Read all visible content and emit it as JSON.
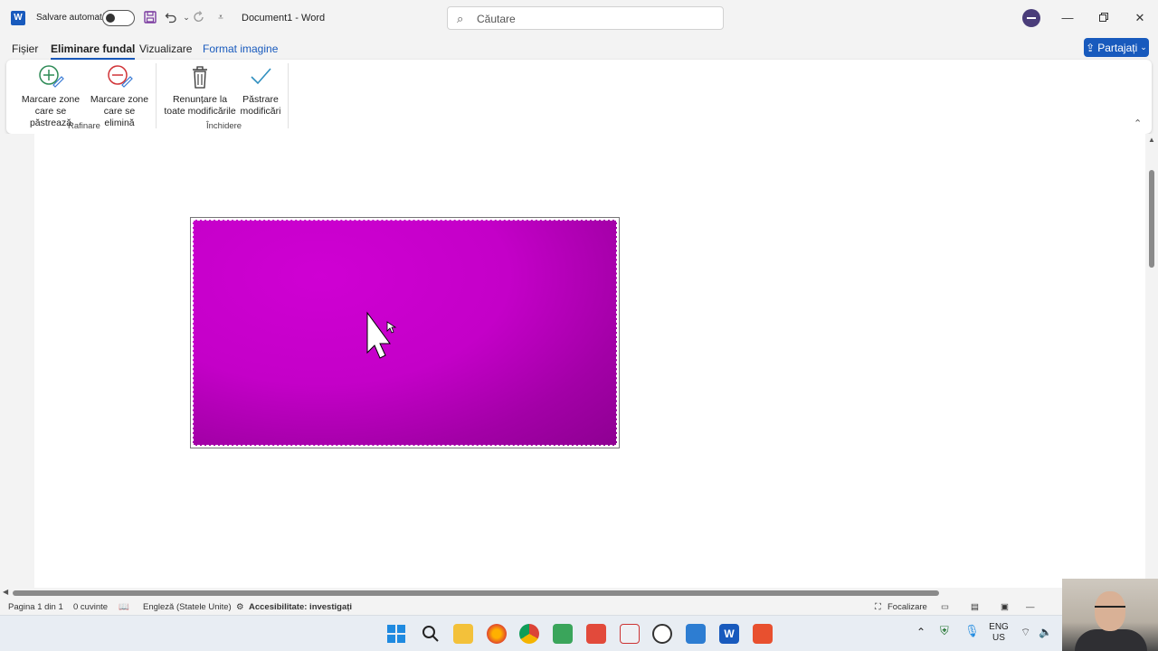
{
  "titlebar": {
    "app_badge": "W",
    "autosave_label": "Salvare automată",
    "doc_title": "Document1  -  Word",
    "search_placeholder": "Căutare"
  },
  "tabs": [
    {
      "label": "Fișier"
    },
    {
      "label": "Eliminare fundal"
    },
    {
      "label": "Vizualizare"
    },
    {
      "label": "Format imagine"
    }
  ],
  "share_label": "Partajați",
  "ribbon": {
    "mark_keep": {
      "line1": "Marcare zone",
      "line2": "care se păstrează"
    },
    "mark_remove": {
      "line1": "Marcare zone",
      "line2": "care se elimină"
    },
    "discard": {
      "line1": "Renunțare la",
      "line2": "toate modificările"
    },
    "keep_changes": {
      "line1": "Păstrare",
      "line2": "modificări"
    },
    "group_refine": "Rafinare",
    "group_close": "Închidere"
  },
  "statusbar": {
    "page": "Pagina 1 din 1",
    "words": "0 cuvinte",
    "language": "Engleză (Statele Unite)",
    "accessibility": "Accesibilitate: investigați",
    "focus": "Focalizare"
  },
  "taskbar": {
    "lang_line1": "ENG",
    "lang_line2": "US"
  },
  "colors": {
    "accent": "#185abd",
    "image_fill": "#c400c8"
  }
}
